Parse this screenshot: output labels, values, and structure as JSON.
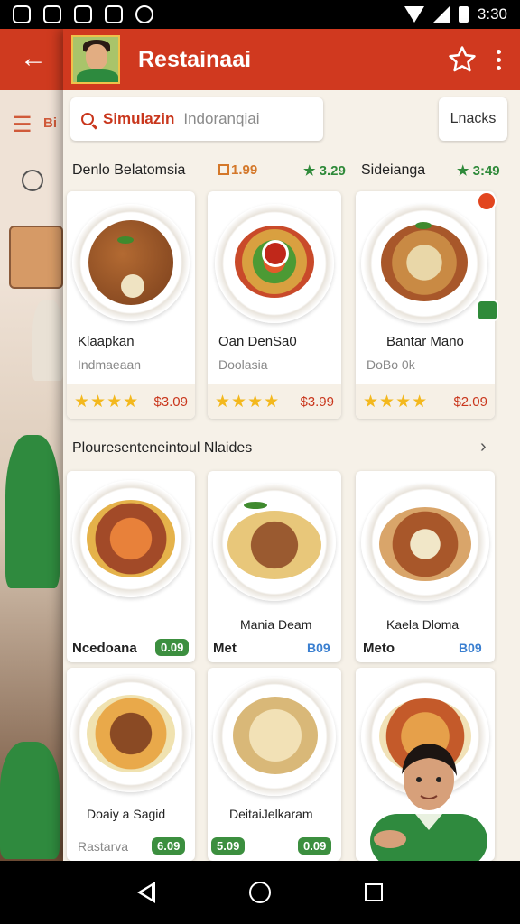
{
  "status_bar": {
    "time": "3:30"
  },
  "toolbar": {
    "title": "Restainaai"
  },
  "background_app": {
    "menu_label": "Bi"
  },
  "search": {
    "value": "Simulazin",
    "placeholder": "Indoranqiai"
  },
  "aside_button": "Lnacks",
  "section1": {
    "header_left": "Denlo Belatomsia",
    "header_badge": "1.99",
    "header_rating": "★ 3.29",
    "header_right": "Sideianga",
    "header_right_rating": "★ 3:49",
    "cards": [
      {
        "name": "Klaapkan",
        "sub": "Indmaeaan",
        "stars": "★★★★",
        "price": "$3.09"
      },
      {
        "name": "Oan DenSa0",
        "sub": "Doolasia",
        "stars": "★★★★",
        "price": "$3.99"
      },
      {
        "name": "Bantar Mano",
        "sub": "DoBo 0k",
        "stars": "★★★★",
        "price": "$2.09"
      }
    ]
  },
  "section2": {
    "title": "Plouresenteneintoul Nlaides",
    "row1": [
      {
        "bottom_label": "Ncedoana",
        "tag": "0.09"
      },
      {
        "name": "Mania Deam",
        "bottom_label": "Met",
        "tag": "B09"
      },
      {
        "name": "Kaela Dloma",
        "bottom_label": "Meto",
        "tag": "B09"
      }
    ],
    "row2": [
      {
        "name": "Doaiy a Sagid",
        "sub": "Rastarva",
        "tag": "6.09"
      },
      {
        "name": "DeitaiJelkaram",
        "tag1": "5.09",
        "tag2": "0.09"
      },
      {
        "name": "",
        "tag": ""
      }
    ]
  },
  "colors": {
    "accent": "#d0391f",
    "rating_green": "#2f8a3a",
    "star": "#f3b81e",
    "price": "#c9361c"
  }
}
